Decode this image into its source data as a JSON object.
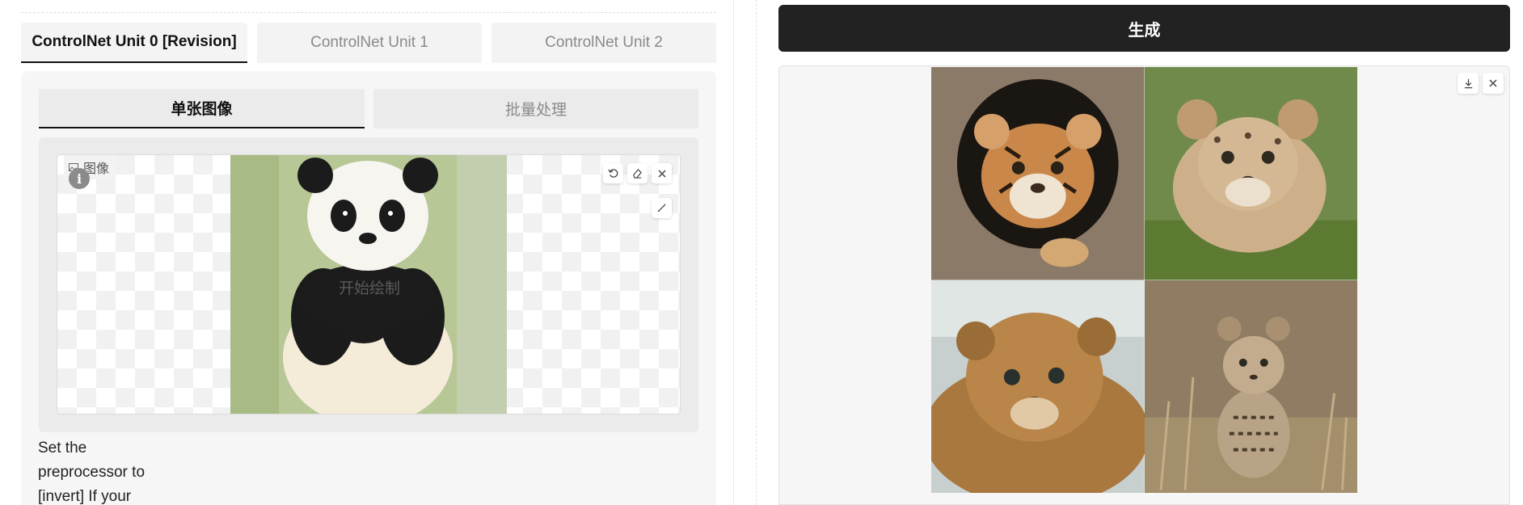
{
  "controlnet": {
    "unit_tabs": [
      {
        "label": "ControlNet Unit 0 [Revision]",
        "active": true
      },
      {
        "label": "ControlNet Unit 1",
        "active": false
      },
      {
        "label": "ControlNet Unit 2",
        "active": false
      }
    ],
    "mode_tabs": [
      {
        "label": "单张图像",
        "active": true
      },
      {
        "label": "批量处理",
        "active": false
      }
    ],
    "image_input": {
      "label": "图像",
      "info_icon": "i",
      "canvas_hint": "开始绘制",
      "tools": [
        "undo-icon",
        "eraser-icon",
        "close-icon",
        "brush-icon"
      ]
    },
    "help_text": "Set the preprocessor to [invert] If your"
  },
  "generate": {
    "label": "生成"
  },
  "gallery": {
    "tools": [
      "download-icon",
      "close-icon"
    ],
    "images": [
      "tiger-cub-in-hole",
      "leopard-cub-in-grass",
      "lynx-kitten-closeup",
      "serval-kitten-in-grass"
    ]
  },
  "colors": {
    "accent": "#222222",
    "panel_bg": "#f6f6f6",
    "inactive_text": "#8a8a8a"
  }
}
